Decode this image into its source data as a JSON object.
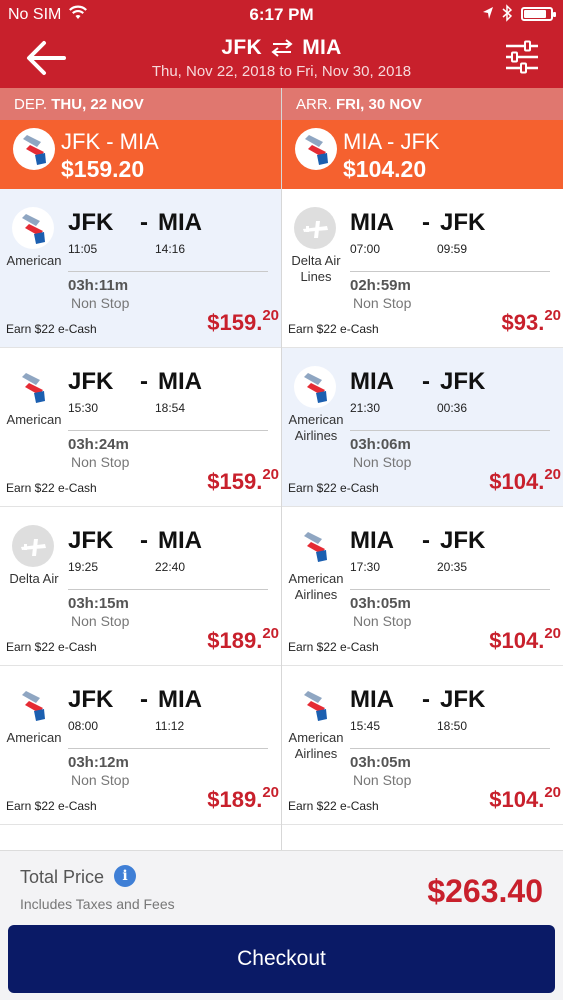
{
  "status_bar": {
    "carrier": "No SIM",
    "time": "6:17 PM",
    "battery_level": 0.85
  },
  "header": {
    "origin": "JFK",
    "destination": "MIA",
    "dates": "Thu, Nov 22, 2018 to Fri, Nov 30, 2018",
    "back_icon": "arrow-left-icon",
    "filter_icon": "sliders-icon",
    "color": "#c8202c"
  },
  "legs": {
    "departure": {
      "label": "DEP.",
      "date": "THU, 22 NOV",
      "route": "JFK - MIA",
      "price": "$159.20"
    },
    "arrival": {
      "label": "ARR.",
      "date": "FRI, 30 NOV",
      "route": "MIA - JFK",
      "price": "$104.20"
    }
  },
  "outbound": [
    {
      "airline": "American",
      "logo": "american",
      "from": "JFK",
      "to": "MIA",
      "dep": "11:05",
      "arr": "14:16",
      "duration": "03h:11m",
      "stops": "Non Stop",
      "ecash": "Earn $22 e-Cash",
      "price_main": "$159.",
      "price_cents": "20",
      "selected": true
    },
    {
      "airline": "American",
      "logo": "american",
      "from": "JFK",
      "to": "MIA",
      "dep": "15:30",
      "arr": "18:54",
      "duration": "03h:24m",
      "stops": "Non Stop",
      "ecash": "Earn $22 e-Cash",
      "price_main": "$159.",
      "price_cents": "20",
      "selected": false
    },
    {
      "airline": "Delta Air",
      "logo": "delta",
      "from": "JFK",
      "to": "MIA",
      "dep": "19:25",
      "arr": "22:40",
      "duration": "03h:15m",
      "stops": "Non Stop",
      "ecash": "Earn $22 e-Cash",
      "price_main": "$189.",
      "price_cents": "20",
      "selected": false
    },
    {
      "airline": "American",
      "logo": "american",
      "from": "JFK",
      "to": "MIA",
      "dep": "08:00",
      "arr": "11:12",
      "duration": "03h:12m",
      "stops": "Non Stop",
      "ecash": "Earn $22 e-Cash",
      "price_main": "$189.",
      "price_cents": "20",
      "selected": false
    }
  ],
  "inbound": [
    {
      "airline": "Delta Air\nLines",
      "logo": "delta",
      "from": "MIA",
      "to": "JFK",
      "dep": "07:00",
      "arr": "09:59",
      "duration": "02h:59m",
      "stops": "Non Stop",
      "ecash": "Earn $22 e-Cash",
      "price_main": "$93.",
      "price_cents": "20",
      "selected": false
    },
    {
      "airline": "American\nAirlines",
      "logo": "american",
      "from": "MIA",
      "to": "JFK",
      "dep": "21:30",
      "arr": "00:36",
      "duration": "03h:06m",
      "stops": "Non Stop",
      "ecash": "Earn $22 e-Cash",
      "price_main": "$104.",
      "price_cents": "20",
      "selected": true
    },
    {
      "airline": "American\nAirlines",
      "logo": "american",
      "from": "MIA",
      "to": "JFK",
      "dep": "17:30",
      "arr": "20:35",
      "duration": "03h:05m",
      "stops": "Non Stop",
      "ecash": "Earn $22 e-Cash",
      "price_main": "$104.",
      "price_cents": "20",
      "selected": false
    },
    {
      "airline": "American\nAirlines",
      "logo": "american",
      "from": "MIA",
      "to": "JFK",
      "dep": "15:45",
      "arr": "18:50",
      "duration": "03h:05m",
      "stops": "Non Stop",
      "ecash": "Earn $22 e-Cash",
      "price_main": "$104.",
      "price_cents": "20",
      "selected": false
    }
  ],
  "footer": {
    "total_label": "Total Price",
    "info_icon": "i",
    "taxes_note": "Includes Taxes and Fees",
    "total_price": "$263.40",
    "checkout_label": "Checkout"
  }
}
